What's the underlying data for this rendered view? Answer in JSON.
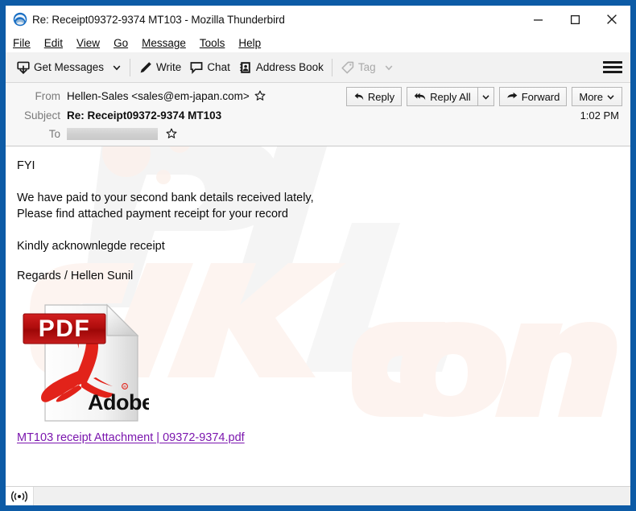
{
  "window": {
    "title": "Re: Receipt09372-9374 MT103 - Mozilla Thunderbird",
    "app_icon": "thunderbird-icon",
    "minimize_label": "–",
    "maximize_label": "□",
    "close_label": "✕",
    "frame_color": "#0d5ba6"
  },
  "menubar": {
    "items": [
      {
        "label": "File",
        "accesskey": "F"
      },
      {
        "label": "Edit",
        "accesskey": "E"
      },
      {
        "label": "View",
        "accesskey": "V"
      },
      {
        "label": "Go",
        "accesskey": "G"
      },
      {
        "label": "Message",
        "accesskey": "M"
      },
      {
        "label": "Tools",
        "accesskey": "T"
      },
      {
        "label": "Help",
        "accesskey": "H"
      }
    ]
  },
  "toolbar": {
    "get_messages": "Get Messages",
    "write": "Write",
    "chat": "Chat",
    "address_book": "Address Book",
    "tag": "Tag",
    "tag_disabled": true,
    "menu_icon": "hamburger-icon"
  },
  "message_header": {
    "from_label": "From",
    "from_value": "Hellen-Sales <sales@em-japan.com>",
    "subject_label": "Subject",
    "subject_value": "Re: Receipt09372-9374 MT103",
    "to_label": "To",
    "to_value": "",
    "time": "1:02 PM",
    "actions": {
      "reply": "Reply",
      "reply_all": "Reply All",
      "forward": "Forward",
      "more": "More"
    }
  },
  "body": {
    "line_1": "FYI",
    "line_2": "We have paid to your second bank details received lately,",
    "line_3": "Please find attached payment receipt for your record",
    "line_4": "Kindly acknownlegde receipt",
    "line_5": "Regards / Hellen Sunil",
    "attachment": {
      "icon": "pdf-file-icon",
      "badge_text": "PDF",
      "brand_text": "Adobe",
      "link_text": "MT103 receipt Attachment | 09372-9374.pdf",
      "link_color": "#7b16ae"
    },
    "watermark_text": "pcrisk.com"
  },
  "statusbar": {
    "icon": "broadcast-icon",
    "text": ""
  }
}
